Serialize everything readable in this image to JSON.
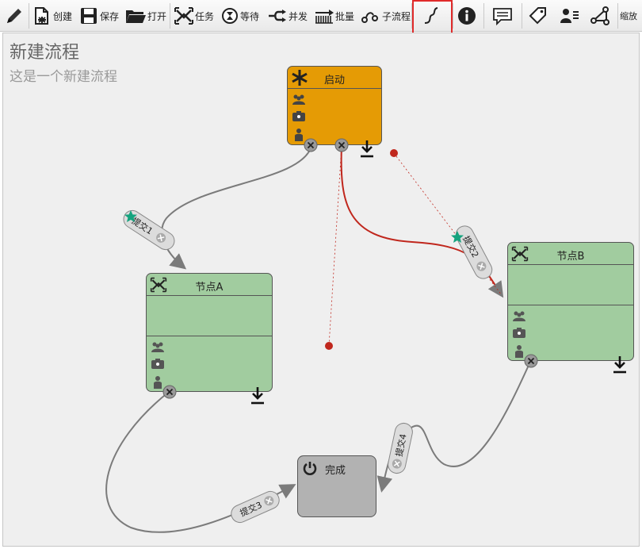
{
  "toolbar": {
    "items": [
      {
        "id": "edit",
        "icon": "pencil-icon",
        "label": ""
      },
      {
        "id": "create",
        "icon": "new-document-icon",
        "label": "创建"
      },
      {
        "id": "save",
        "icon": "floppy-disk-icon",
        "label": "保存"
      },
      {
        "id": "open",
        "icon": "folder-icon",
        "label": "打开"
      },
      {
        "id": "task",
        "icon": "task-cross-icon",
        "label": "任务"
      },
      {
        "id": "wait",
        "icon": "hourglass-icon",
        "label": "等待"
      },
      {
        "id": "parallel",
        "icon": "fork-arrow-icon",
        "label": "并发"
      },
      {
        "id": "batch",
        "icon": "batch-arrow-icon",
        "label": "批量"
      },
      {
        "id": "subprocess",
        "icon": "subflow-icon",
        "label": "子流程"
      },
      {
        "id": "connector",
        "icon": "curve-connector-icon",
        "label": "",
        "selected": true
      },
      {
        "id": "info",
        "icon": "info-icon",
        "label": ""
      },
      {
        "id": "comment",
        "icon": "comment-icon",
        "label": ""
      },
      {
        "id": "tag",
        "icon": "tag-icon",
        "label": ""
      },
      {
        "id": "users",
        "icon": "user-list-icon",
        "label": ""
      },
      {
        "id": "network",
        "icon": "network-icon",
        "label": ""
      },
      {
        "id": "zoom",
        "icon": "",
        "label": "缩放"
      }
    ],
    "selected_outline_color": "#e02b2b"
  },
  "process": {
    "title": "新建流程",
    "description": "这是一个新建流程"
  },
  "nodes": {
    "start": {
      "name": "启动",
      "color": "#e59b05",
      "icon": "asterisk-icon"
    },
    "node_a": {
      "name": "节点A",
      "color": "#a1cc9f",
      "icon": "task-cross-icon"
    },
    "node_b": {
      "name": "节点B",
      "color": "#a1cc9f",
      "icon": "task-cross-icon"
    },
    "end": {
      "name": "完成",
      "color": "#b2b2b2",
      "icon": "power-icon"
    }
  },
  "transitions": [
    {
      "label": "提交1",
      "from": "启动",
      "to": "节点A"
    },
    {
      "label": "提交2",
      "from": "启动",
      "to": "节点B",
      "selected": true
    },
    {
      "label": "提交3",
      "from": "节点A",
      "to": "完成"
    },
    {
      "label": "提交4",
      "from": "节点B",
      "to": "完成"
    }
  ],
  "colors": {
    "selected_wire": "#c0271d",
    "wire": "#7b7b7b",
    "handle_dot": "#c0271d",
    "star": "#15a37e"
  }
}
